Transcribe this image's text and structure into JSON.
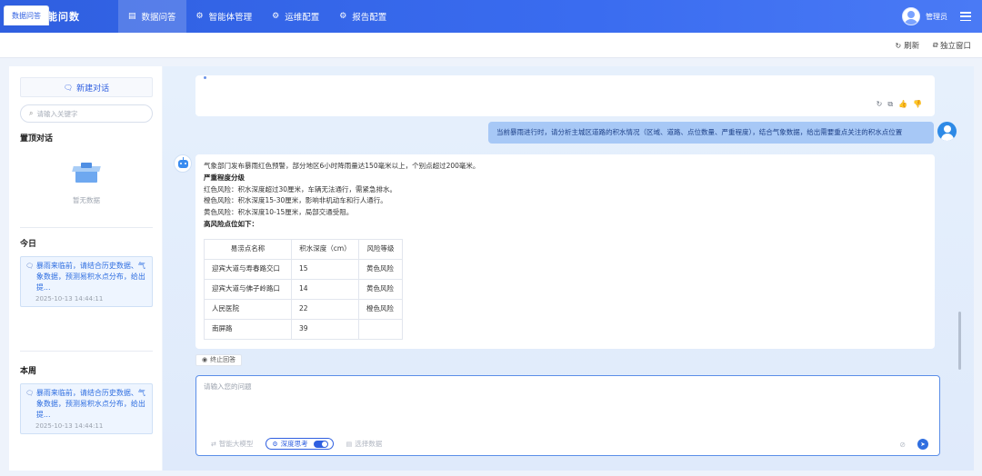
{
  "app": {
    "title": "智能问数"
  },
  "nav": [
    {
      "label": "数据问答",
      "icon": "doc-icon",
      "active": true
    },
    {
      "label": "智能体管理",
      "icon": "gear-icon",
      "active": false
    },
    {
      "label": "运维配置",
      "icon": "gear-icon",
      "active": false
    },
    {
      "label": "报告配置",
      "icon": "gear-icon",
      "active": false
    }
  ],
  "user": {
    "name": "管理员"
  },
  "tabs": {
    "active": "数据问答",
    "refresh": "刷新",
    "detach": "独立窗口"
  },
  "sidebar": {
    "new_chat": "新建对话",
    "search_placeholder": "请输入关键字",
    "pinned_title": "置顶对话",
    "empty_text": "暂无数据",
    "today_title": "今日",
    "week_title": "本周",
    "today_items": [
      {
        "title": "暴雨来临前，请结合历史数据、气象数据，预测易积水点分布，给出提...",
        "date": "2025-10-13 14:44:11"
      }
    ],
    "week_items": [
      {
        "title": "暴雨来临前，请结合历史数据、气象数据，预测易积水点分布，给出提...",
        "date": "2025-10-13 14:44:11"
      }
    ]
  },
  "chat": {
    "user_message": "当前暴雨进行时，请分析主城区道路的积水情况（区域、道路、点位数量、严重程度），结合气象数据，给出需要重点关注的积水点位置",
    "answer": {
      "intro": "气象部门发布暴雨红色预警，部分地区6小时降雨量达150毫米以上，个别点超过200毫米。",
      "severity_title": "严重程度分级",
      "red": "红色风险：积水深度超过30厘米，车辆无法通行，需紧急排水。",
      "orange": "橙色风险：积水深度15-30厘米，影响非机动车和行人通行。",
      "yellow": "黄色风险：积水深度10-15厘米，局部交通受阻。",
      "hotspot_title": "高风险点位如下：",
      "table": {
        "headers": [
          "易涝点名称",
          "积水深度（cm）",
          "风险等级"
        ],
        "rows": [
          [
            "迎宾大道与寿春路交口",
            "15",
            "黄色风险"
          ],
          [
            "迎宾大道与佛子岭路口",
            "14",
            "黄色风险"
          ],
          [
            "人民医院",
            "22",
            "橙色风险"
          ],
          [
            "南屏路",
            "39",
            ""
          ]
        ]
      }
    },
    "stop_label": "终止回答",
    "input_placeholder": "请输入您的问题",
    "tools": {
      "model": "智能大模型",
      "deep_think": "深度思考",
      "select_data": "选择数据"
    }
  }
}
